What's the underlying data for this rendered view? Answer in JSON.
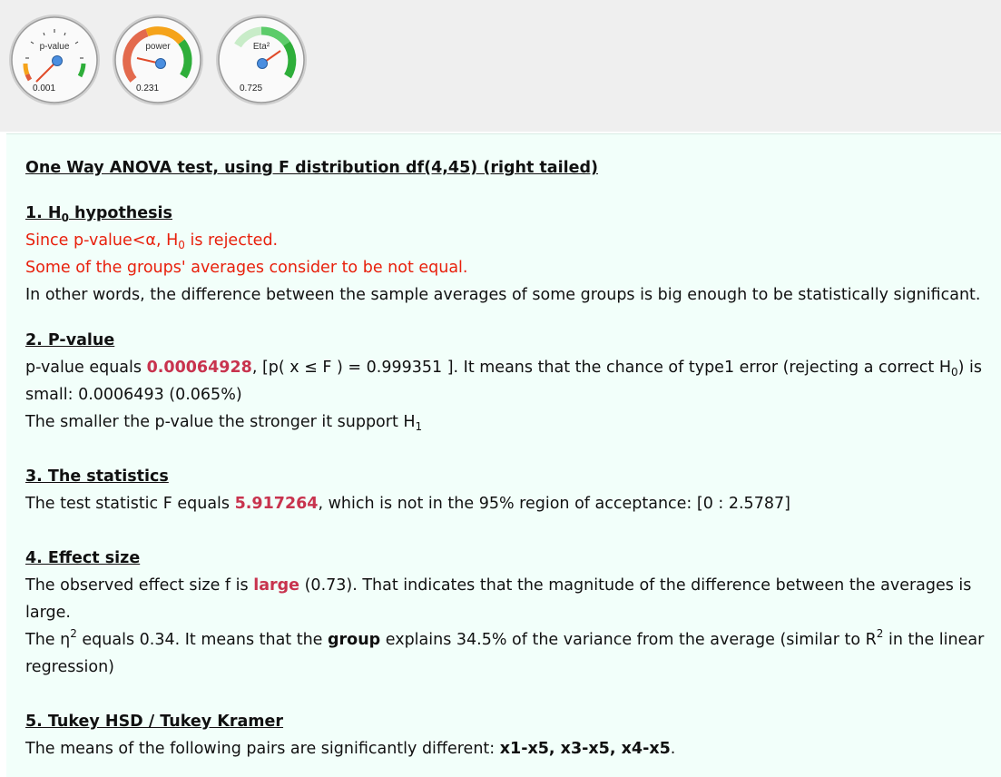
{
  "gauges": [
    {
      "title": "p-value",
      "value_text": "0.001",
      "level": 0.001
    },
    {
      "title": "power",
      "value_text": "0.231",
      "level": 0.231
    },
    {
      "title": "Eta²",
      "value_text": "0.725",
      "level": 0.725
    }
  ],
  "colors": {
    "red": "#e8200c",
    "highlight": "#c8334e",
    "panel": "#f2fffa",
    "gauge_green": "#2eae3a",
    "gauge_orange": "#f5a31a",
    "gauge_red": "#e05a3a"
  },
  "title": "One Way ANOVA test, using F distribution df(4,45) (right tailed)",
  "s1": {
    "heading_a": "1. H",
    "heading_sub": "0",
    "heading_b": " hypothesis",
    "l1_a": "Since p-value<α, H",
    "l1_sub": "0",
    "l1_b": " is rejected.",
    "l2": "Some of the groups' averages consider to be not equal.",
    "l3": "In other words, the difference between the sample averages of some groups is big enough to be statistically significant."
  },
  "s2": {
    "heading": "2. P-value",
    "a": "p-value equals ",
    "pvalue": "0.00064928",
    "b": ", [p( x ≤ F ) = 0.999351 ]. It means that the chance of type1 error (rejecting a correct H",
    "b_sub": "0",
    "c": ") is small: 0.0006493 (0.065%)",
    "l2_a": "The smaller the p-value the stronger it support H",
    "l2_sub": "1"
  },
  "s3": {
    "heading": "3. The statistics",
    "a": "The test statistic F equals ",
    "f": "5.917264",
    "b": ", which is not in the 95% region of acceptance: [0 : 2.5787]"
  },
  "s4": {
    "heading": "4. Effect size",
    "a": "The observed effect size f is ",
    "size": "large",
    "b": " (0.73). That indicates that the magnitude of the difference between the averages is large.",
    "l2_a": "The η",
    "l2_sup": "2",
    "l2_b": " equals 0.34. It means that the ",
    "l2_group": "group",
    "l2_c": " explains 34.5% of the variance from the average (similar to R",
    "l2_sup2": "2",
    "l2_d": " in the linear regression)"
  },
  "s5": {
    "heading": "5. Tukey HSD / Tukey Kramer",
    "a": "The means of the following pairs are significantly different: ",
    "pairs": "x1-x5, x3-x5, x4-x5",
    "end": "."
  }
}
